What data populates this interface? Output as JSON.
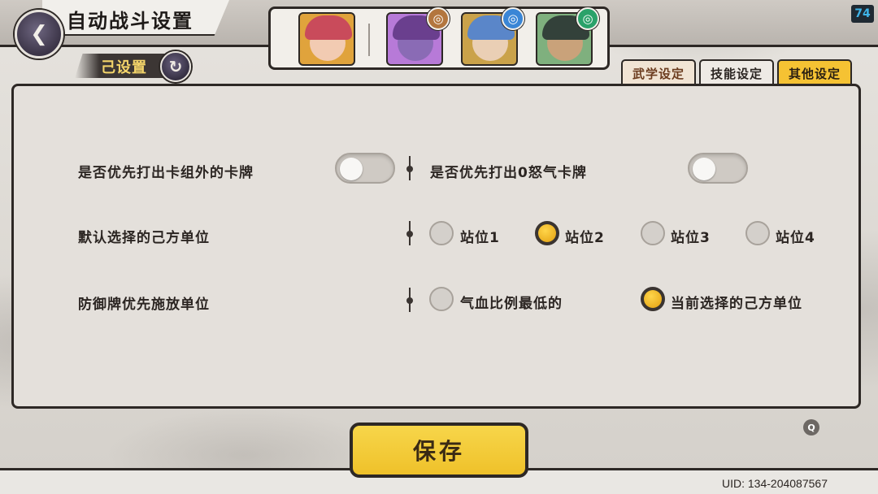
{
  "header": {
    "title": "自动战斗设置",
    "back_icon": "back-arrow-icon",
    "sub_tag": "己设置",
    "swap_icon": "swap-cycle-icon",
    "level": "74"
  },
  "heroes": [
    {
      "name": "hero-1",
      "hair": "#c94b5b",
      "skin": "#f2cbb2",
      "bg": "#e0a33c",
      "badge": null
    },
    {
      "name": "hero-2",
      "hair": "#6a3f8e",
      "skin": "#8a6bb5",
      "bg": "#b77ad8",
      "badge": {
        "icon": "earth-element-icon",
        "color": "#b3763e"
      }
    },
    {
      "name": "hero-3",
      "hair": "#5a86c9",
      "skin": "#eacfb5",
      "bg": "#caa24a",
      "badge": {
        "icon": "water-element-icon",
        "color": "#3a86d6"
      }
    },
    {
      "name": "hero-4",
      "hair": "#33413a",
      "skin": "#c9a27a",
      "bg": "#7fb07e",
      "badge": {
        "icon": "wind-element-icon",
        "color": "#2aa26a"
      }
    }
  ],
  "tabs": [
    {
      "label": "武学设定",
      "active": false
    },
    {
      "label": "技能设定",
      "active": false
    },
    {
      "label": "其他设定",
      "active": true
    }
  ],
  "settings": {
    "row1": {
      "left_label": "是否优先打出卡组外的卡牌",
      "left_toggle_on": false,
      "right_label": "是否优先打出0怒气卡牌",
      "right_toggle_on": false
    },
    "row2": {
      "label": "默认选择的己方单位",
      "options": [
        {
          "label": "站位1",
          "selected": false
        },
        {
          "label": "站位2",
          "selected": true
        },
        {
          "label": "站位3",
          "selected": false
        },
        {
          "label": "站位4",
          "selected": false
        }
      ]
    },
    "row3": {
      "label": "防御牌优先施放单位",
      "options": [
        {
          "label": "气血比例最低的",
          "selected": false
        },
        {
          "label": "当前选择的己方单位",
          "selected": true
        }
      ]
    }
  },
  "save_label": "保存",
  "help_label": "Q",
  "uid": "UID:  134-204087567"
}
